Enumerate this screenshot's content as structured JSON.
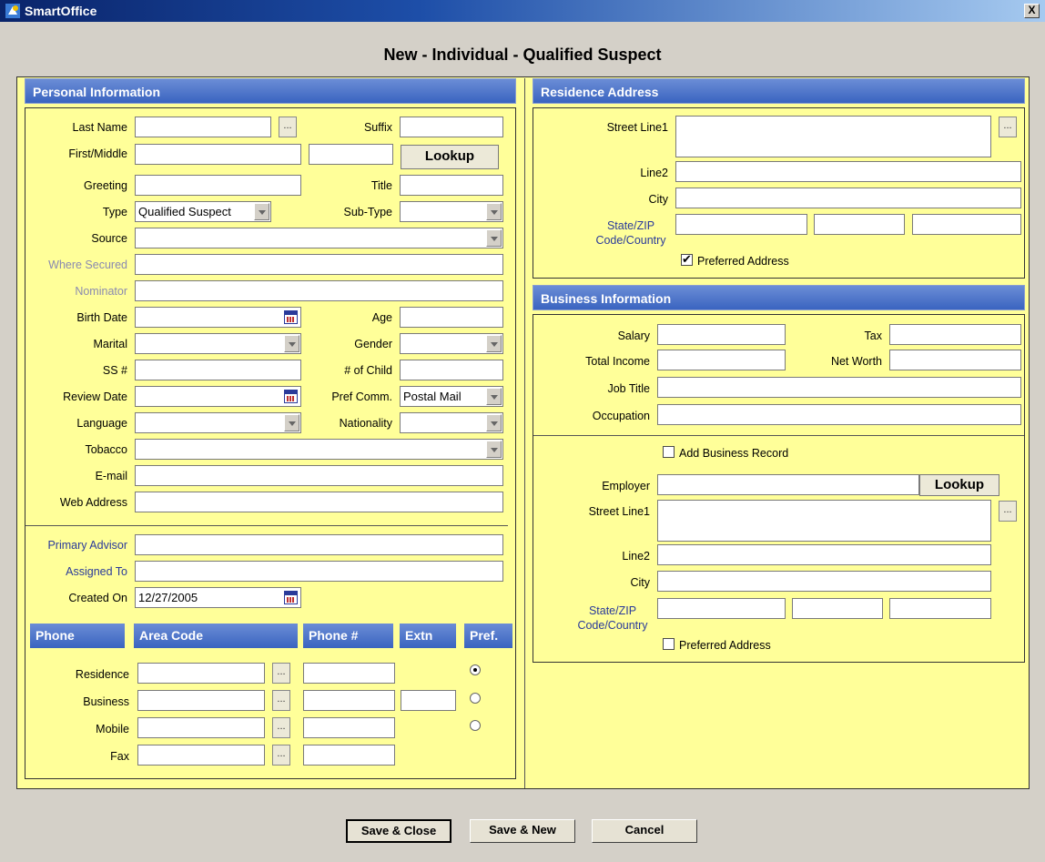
{
  "window": {
    "title": "SmartOffice",
    "close_label": "X"
  },
  "page_title": "New - Individual - Qualified Suspect",
  "personal": {
    "header": "Personal Information",
    "last_name_label": "Last Name",
    "last_name_value": "",
    "suffix_label": "Suffix",
    "first_middle_label": "First/Middle",
    "lookup_label": "Lookup",
    "greeting_label": "Greeting",
    "title_label": "Title",
    "type_label": "Type",
    "type_value": "Qualified Suspect",
    "subtype_label": "Sub-Type",
    "source_label": "Source",
    "where_secured_label": "Where Secured",
    "nominator_label": "Nominator",
    "birth_date_label": "Birth Date",
    "age_label": "Age",
    "marital_label": "Marital",
    "gender_label": "Gender",
    "ss_label": "SS #",
    "child_label": "# of Child",
    "review_date_label": "Review Date",
    "pref_comm_label": "Pref Comm.",
    "pref_comm_value": "Postal Mail",
    "language_label": "Language",
    "nationality_label": "Nationality",
    "tobacco_label": "Tobacco",
    "email_label": "E-mail",
    "web_label": "Web Address",
    "primary_advisor_label": "Primary Advisor",
    "assigned_to_label": "Assigned To",
    "created_on_label": "Created On",
    "created_on_value": "12/27/2005"
  },
  "phone": {
    "headers": {
      "phone": "Phone",
      "area_code": "Area Code",
      "phone_no": "Phone #",
      "extn": "Extn",
      "pref": "Pref."
    },
    "rows": [
      {
        "label": "Residence",
        "preferred": true
      },
      {
        "label": "Business",
        "preferred": false
      },
      {
        "label": "Mobile",
        "preferred": false
      },
      {
        "label": "Fax"
      }
    ]
  },
  "residence": {
    "header": "Residence Address",
    "street1_label": "Street Line1",
    "line2_label": "Line2",
    "city_label": "City",
    "state_zip_label": "State/ZIP Code/Country",
    "preferred_label": "Preferred Address",
    "preferred_checked": true
  },
  "business": {
    "header": "Business Information",
    "salary_label": "Salary",
    "tax_label": "Tax",
    "total_income_label": "Total Income",
    "net_worth_label": "Net Worth",
    "job_title_label": "Job Title",
    "occupation_label": "Occupation",
    "add_record_label": "Add Business Record",
    "employer_label": "Employer",
    "lookup_label": "Lookup",
    "street1_label": "Street Line1",
    "line2_label": "Line2",
    "city_label": "City",
    "state_zip_label": "State/ZIP Code/Country",
    "preferred_label": "Preferred Address"
  },
  "actions": {
    "save_close": "Save & Close",
    "save_new": "Save & New",
    "cancel": "Cancel"
  },
  "dots_label": "...",
  "colors": {
    "form_bg": "#ffff99",
    "header_blue": "#3a64c0",
    "title_bar": "#0a246a"
  }
}
